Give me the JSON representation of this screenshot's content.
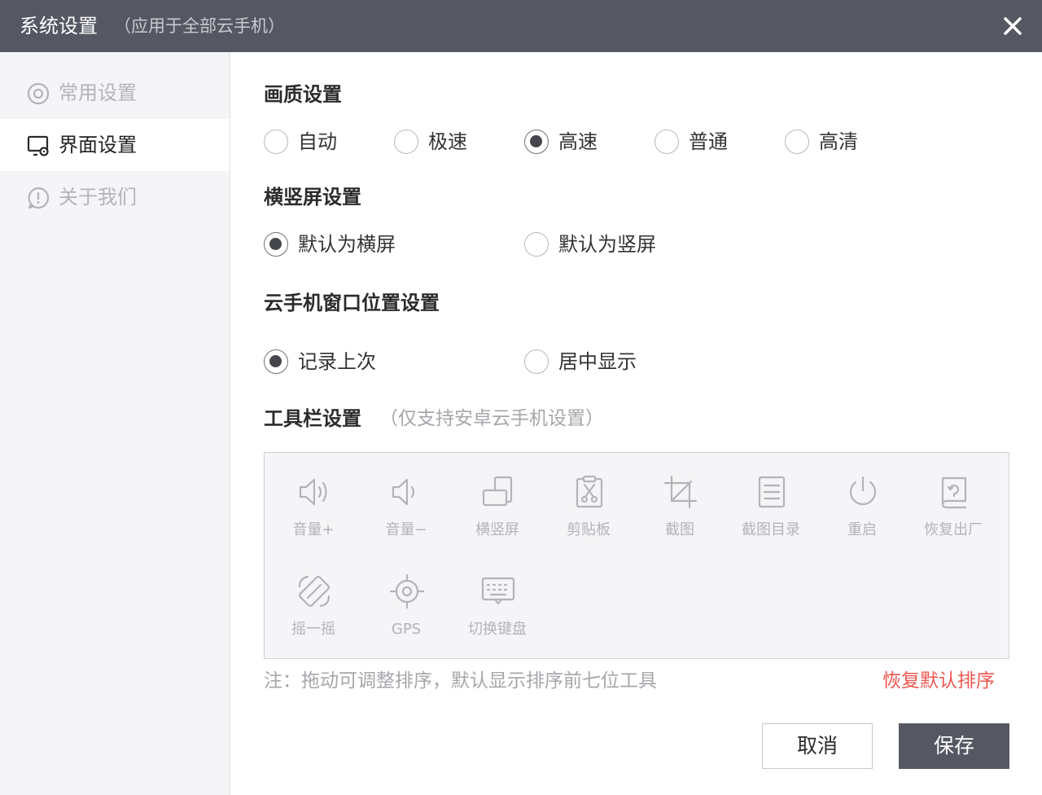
{
  "window": {
    "title": "系统设置",
    "subtitle": "（应用于全部云手机）"
  },
  "sidebar": {
    "items": [
      {
        "label": "常用设置",
        "icon": "settings-icon",
        "active": false
      },
      {
        "label": "界面设置",
        "icon": "display-settings-icon",
        "active": true
      },
      {
        "label": "关于我们",
        "icon": "info-icon",
        "active": false
      }
    ]
  },
  "quality": {
    "title": "画质设置",
    "options": [
      "自动",
      "极速",
      "高速",
      "普通",
      "高清"
    ],
    "selected": "高速"
  },
  "orientation": {
    "title": "横竖屏设置",
    "options": [
      "默认为横屏",
      "默认为竖屏"
    ],
    "selected": "默认为横屏"
  },
  "window_position": {
    "title": "云手机窗口位置设置",
    "options": [
      "记录上次",
      "居中显示"
    ],
    "selected": "记录上次"
  },
  "toolbar": {
    "title": "工具栏设置",
    "note": "（仅支持安卓云手机设置）",
    "tools": [
      {
        "label": "音量+",
        "icon": "volume-up-icon"
      },
      {
        "label": "音量−",
        "icon": "volume-down-icon"
      },
      {
        "label": "横竖屏",
        "icon": "rotate-screen-icon"
      },
      {
        "label": "剪贴板",
        "icon": "clipboard-icon"
      },
      {
        "label": "截图",
        "icon": "crop-icon"
      },
      {
        "label": "截图目录",
        "icon": "screenshot-folder-icon"
      },
      {
        "label": "重启",
        "icon": "power-icon"
      },
      {
        "label": "恢复出厂",
        "icon": "factory-reset-icon"
      },
      {
        "label": "摇一摇",
        "icon": "shake-icon"
      },
      {
        "label": "GPS",
        "icon": "gps-icon"
      },
      {
        "label": "切换键盘",
        "icon": "keyboard-icon"
      }
    ]
  },
  "footer": {
    "note": "注：拖动可调整排序，默认显示排序前七位工具",
    "reset_label": "恢复默认排序",
    "cancel_label": "取消",
    "save_label": "保存"
  },
  "colors": {
    "titlebar": "#555762",
    "accent_red": "#f0564f",
    "save_button": "#555762"
  }
}
